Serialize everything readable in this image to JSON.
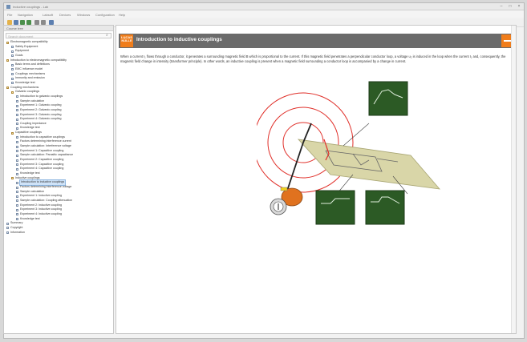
{
  "window": {
    "title": "Inductive couplings - Lab",
    "minimize": "–",
    "maximize": "□",
    "close": "×"
  },
  "menu": [
    "File",
    "Navigation",
    "Labsoft",
    "Devices",
    "Windows",
    "Configuration",
    "Help"
  ],
  "toolbar": {
    "icons": [
      "open-icon",
      "save-icon",
      "back-icon",
      "forward-icon",
      "home-icon",
      "print-icon",
      "help-icon"
    ]
  },
  "sidebar": {
    "header": "Course tree",
    "search_placeholder": "Search document",
    "items": [
      {
        "label": "Electromagnetic compatibility",
        "level": 0,
        "type": "folder"
      },
      {
        "label": "Safety Equipment",
        "level": 1,
        "type": "page"
      },
      {
        "label": "Equipment",
        "level": 1,
        "type": "page"
      },
      {
        "label": "Goals",
        "level": 1,
        "type": "page"
      },
      {
        "label": "Introduction to electromagnetic compatibility",
        "level": 0,
        "type": "folder"
      },
      {
        "label": "Basic terms and definitions",
        "level": 1,
        "type": "page"
      },
      {
        "label": "EMC influence model",
        "level": 1,
        "type": "page"
      },
      {
        "label": "Couplings mechanisms",
        "level": 1,
        "type": "page"
      },
      {
        "label": "Immunity and emission",
        "level": 1,
        "type": "page"
      },
      {
        "label": "Knowledge test",
        "level": 1,
        "type": "page"
      },
      {
        "label": "Coupling mechanisms",
        "level": 0,
        "type": "folder"
      },
      {
        "label": "Galvanic couplings",
        "level": 1,
        "type": "folder"
      },
      {
        "label": "Introduction to galvanic couplings",
        "level": 2,
        "type": "page"
      },
      {
        "label": "Sample calculation",
        "level": 2,
        "type": "page"
      },
      {
        "label": "Experiment 1: Galvanic coupling",
        "level": 2,
        "type": "page"
      },
      {
        "label": "Experiment 2: Galvanic coupling",
        "level": 2,
        "type": "page"
      },
      {
        "label": "Experiment 3: Galvanic coupling",
        "level": 2,
        "type": "page"
      },
      {
        "label": "Experiment 4: Galvanic coupling",
        "level": 2,
        "type": "page"
      },
      {
        "label": "Coupling impedance",
        "level": 2,
        "type": "page"
      },
      {
        "label": "Knowledge test",
        "level": 2,
        "type": "page"
      },
      {
        "label": "Capacitive couplings",
        "level": 1,
        "type": "folder"
      },
      {
        "label": "Introduction to capacitive couplings",
        "level": 2,
        "type": "page"
      },
      {
        "label": "Factors determining interference current",
        "level": 2,
        "type": "page"
      },
      {
        "label": "Sample calculation: Interference voltage",
        "level": 2,
        "type": "page"
      },
      {
        "label": "Experiment 1: Capacitive coupling",
        "level": 2,
        "type": "page"
      },
      {
        "label": "Sample calculation: Parasitic capacitance",
        "level": 2,
        "type": "page"
      },
      {
        "label": "Experiment 2: Capacitive coupling",
        "level": 2,
        "type": "page"
      },
      {
        "label": "Experiment 3: Capacitive coupling",
        "level": 2,
        "type": "page"
      },
      {
        "label": "Experiment 4: Capacitive coupling",
        "level": 2,
        "type": "page"
      },
      {
        "label": "Knowledge test",
        "level": 2,
        "type": "page"
      },
      {
        "label": "Inductive couplings",
        "level": 1,
        "type": "folder"
      },
      {
        "label": "Introduction to inductive couplings",
        "level": 2,
        "type": "page",
        "selected": true
      },
      {
        "label": "Factors determining interference voltage",
        "level": 2,
        "type": "page"
      },
      {
        "label": "Sample calculation",
        "level": 2,
        "type": "page"
      },
      {
        "label": "Experiment 1: Inductive coupling",
        "level": 2,
        "type": "page"
      },
      {
        "label": "Sample calculation: Coupling attenuation",
        "level": 2,
        "type": "page"
      },
      {
        "label": "Experiment 2: Inductive coupling",
        "level": 2,
        "type": "page"
      },
      {
        "label": "Experiment 3: Inductive coupling",
        "level": 2,
        "type": "page"
      },
      {
        "label": "Experiment 4: Inductive coupling",
        "level": 2,
        "type": "page"
      },
      {
        "label": "Knowledge test",
        "level": 2,
        "type": "page"
      },
      {
        "label": "Summary",
        "level": 0,
        "type": "page"
      },
      {
        "label": "Copyright",
        "level": 0,
        "type": "page"
      },
      {
        "label": "Information",
        "level": 0,
        "type": "page"
      }
    ]
  },
  "content": {
    "logo_text": "LUCAS NÜLLE",
    "title": "Introduction to inductive couplings",
    "paragraph": "When a current I₁ flows through a conductor, it generates a surrounding magnetic field B which is proportional to the current. If this magnetic field penetrates a perpendicular conductor loop, a voltage u₂ is induced in the loop when the current I₁ and, consequently, the magnetic field change in intensity (transformer principle). In other words, an inductive coupling is present when a magnetic field surrounding a conductor loop is accompanied by a change in current."
  },
  "colors": {
    "accent": "#f07d1b",
    "header": "#6b6b6b",
    "scope": "#2c5a25",
    "field": "#e0302a",
    "board": "#d9d6a8"
  }
}
